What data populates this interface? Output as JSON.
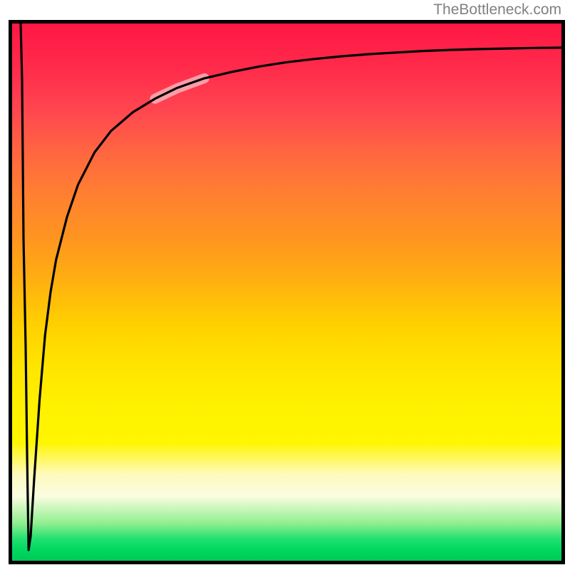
{
  "watermark": "TheBottleneck.com",
  "chart_data": {
    "type": "line",
    "title": "",
    "xlabel": "",
    "ylabel": "",
    "xlim": [
      0,
      100
    ],
    "ylim": [
      0,
      100
    ],
    "series": [
      {
        "name": "bottleneck-curve",
        "x": [
          0,
          1,
          2,
          3,
          4,
          5,
          6,
          7,
          8,
          10,
          12,
          15,
          18,
          22,
          26,
          30,
          35,
          40,
          45,
          50,
          55,
          60,
          65,
          70,
          75,
          80,
          85,
          90,
          95,
          100
        ],
        "values": [
          100,
          60,
          20,
          2,
          15,
          30,
          42,
          50,
          56,
          64,
          70,
          76,
          80,
          83.5,
          86,
          88,
          89.8,
          91,
          92,
          92.8,
          93.4,
          93.9,
          94.3,
          94.6,
          94.9,
          95.1,
          95.3,
          95.45,
          95.55,
          95.6
        ]
      }
    ],
    "gradient_stops": [
      {
        "pos": 0,
        "color": "#ff1744"
      },
      {
        "pos": 50,
        "color": "#ffd000"
      },
      {
        "pos": 80,
        "color": "#fff600"
      },
      {
        "pos": 100,
        "color": "#00c858"
      }
    ],
    "highlight_segment": {
      "x_start": 26,
      "x_end": 35,
      "opacity": 0.4
    }
  }
}
